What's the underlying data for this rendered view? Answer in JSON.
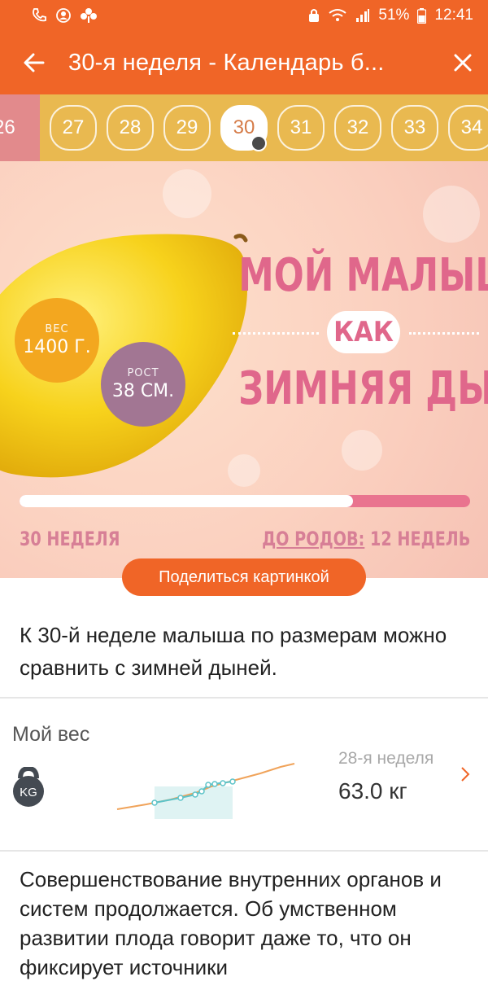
{
  "status_bar": {
    "battery": "51%",
    "time": "12:41"
  },
  "app_bar": {
    "title": "30-я неделя - Календарь б..."
  },
  "weeks": {
    "items": [
      "26",
      "27",
      "28",
      "29",
      "30",
      "31",
      "32",
      "33",
      "34"
    ],
    "selected": "30"
  },
  "hero": {
    "title_line1": "МОЙ МАЛЫШ",
    "title_line2": "КАК",
    "title_line3": "ЗИМНЯЯ ДЫНЯ",
    "weight_caption": "ВЕС",
    "weight_value": "1400 Г.",
    "height_caption": "РОСТ",
    "height_value": "38 СМ.",
    "progress_fraction": 0.74,
    "week_label": "30 НЕДЕЛЯ",
    "remaining_prefix": "ДО РОДОВ:",
    "remaining_value": "12 НЕДЕЛЬ"
  },
  "share_button": "Поделиться картинкой",
  "intro_text": "К 30-й неделе малыша по размерам можно сравнить с зимней дыней.",
  "weight_card": {
    "title": "Мой вес",
    "icon_label": "KG",
    "week": "28-я неделя",
    "value": "63.0 кг"
  },
  "body_text": "Совершенствование внутренних органов и систем продолжается. Об умственном развитии плода говорит даже то, что он фиксирует источники",
  "colors": {
    "accent": "#f06527",
    "week_strip": "#e9b950",
    "hero_pink": "#e0678b",
    "weight_circle": "#f3a71f",
    "height_circle": "#a27693"
  }
}
